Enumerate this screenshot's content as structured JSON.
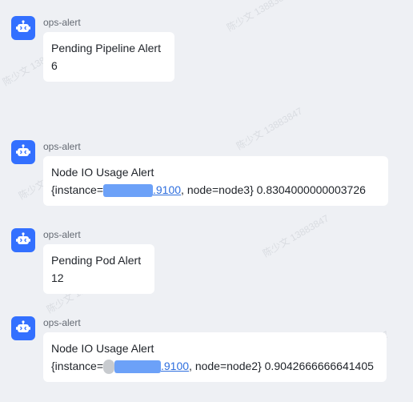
{
  "messages": [
    {
      "sender": "ops-alert",
      "title": "Pending Pipeline Alert",
      "value": "6"
    },
    {
      "sender": "ops-alert",
      "title": "Node IO Usage Alert",
      "prefix": "{instance=",
      "port": ".9100",
      "suffix": ", node=node3} 0.8304000000003726"
    },
    {
      "sender": "ops-alert",
      "title": "Pending Pod Alert",
      "value": "12"
    },
    {
      "sender": "ops-alert",
      "title": "Node IO Usage Alert",
      "prefix": "{instance=",
      "port": ".9100",
      "suffix": ", node=node2} 0.9042666666641405"
    }
  ],
  "watermark": "陈少文 13883847",
  "colors": {
    "avatar": "#3370ff",
    "link": "#2f6fde",
    "background": "#eef0f4"
  },
  "icons": {
    "avatar": "robot-icon"
  }
}
